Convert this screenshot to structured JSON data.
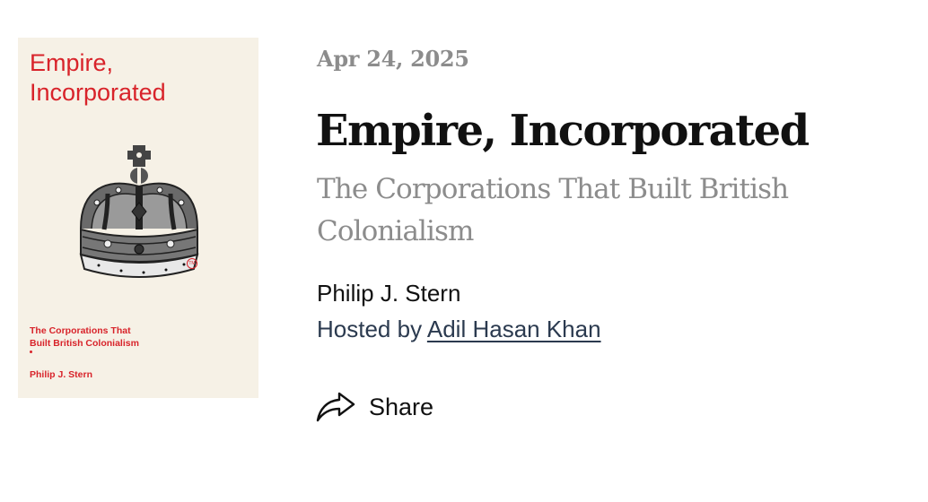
{
  "cover": {
    "title_line1": "Empire,",
    "title_line2": "Incorporated",
    "subtitle_line1": "The Corporations That",
    "subtitle_line2": "Built British Colonialism",
    "author": "Philip J. Stern",
    "mark": "TM",
    "colors": {
      "background": "#f6f1e6",
      "text": "#d8232a"
    }
  },
  "episode": {
    "date": "Apr 24, 2025",
    "title": "Empire, Incorporated",
    "subtitle": "The Corporations That Built British Colonialism",
    "author": "Philip J. Stern",
    "hosted_prefix": "Hosted by",
    "host": "Adil Hasan Khan"
  },
  "actions": {
    "share_label": "Share",
    "share_icon": "share-arrow-icon"
  },
  "colors": {
    "title": "#111111",
    "muted": "#8c8c8c",
    "link": "#2b3a4f"
  }
}
